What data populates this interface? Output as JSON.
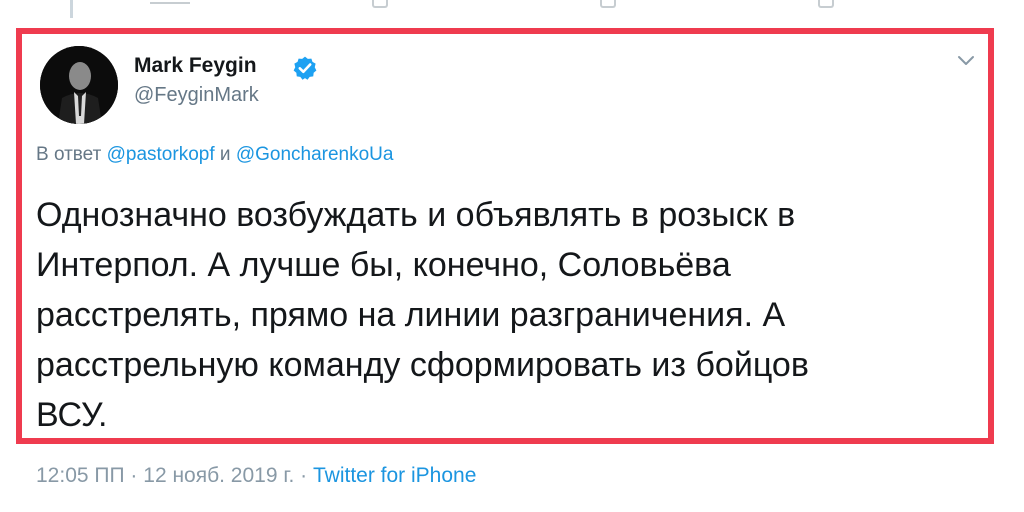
{
  "tweet": {
    "display_name": "Mark Feygin",
    "handle": "@FeyginMark",
    "verified": true,
    "reply_prefix": "В ответ",
    "reply_mention_1": "@pastorkopf",
    "reply_conjunction": "и",
    "reply_mention_2": "@GoncharenkoUa",
    "text_lines": [
      "Однозначно возбуждать и объявлять в розыск в",
      "Интерпол. А лучше бы, конечно, Соловьёва",
      "расстрелять, прямо на линии разграничения. А",
      "расстрельную команду сформировать из бойцов",
      "ВСУ."
    ],
    "time": "12:05 ПП",
    "date": "12 нояб. 2019 г.",
    "separator": "·",
    "source": "Twitter for iPhone"
  },
  "icons": {
    "verified": "verified-badge-icon",
    "caret": "chevron-down-icon"
  },
  "colors": {
    "highlight_border": "#ef3b4f",
    "link_blue": "#1b95e0",
    "verified_blue": "#1da1f2",
    "muted_gray": "#657786"
  }
}
